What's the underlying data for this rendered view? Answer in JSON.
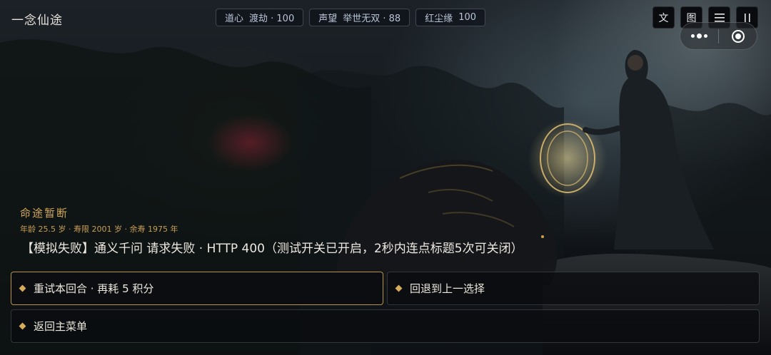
{
  "app": {
    "title": "一念仙途"
  },
  "stats": [
    {
      "label": "道心",
      "value": "渡劫 · 100"
    },
    {
      "label": "声望",
      "value": "举世无双 · 88"
    },
    {
      "label": "红尘缘",
      "value": "100"
    }
  ],
  "toolbar": {
    "text_label": "文",
    "image_label": "图",
    "menu_icon": "menu-icon",
    "pause_icon": "pause-icon"
  },
  "capsule": {
    "more_icon": "more-dots-icon",
    "close_icon": "target-close-icon"
  },
  "fate": {
    "title": "命途暂断",
    "meta": "年龄 25.5 岁 · 寿限 2001 岁 · 余寿 1975 年",
    "message": "【模拟失败】通义千问 请求失败 · HTTP 400（测试开关已开启，2秒内连点标题5次可关闭）"
  },
  "options": [
    {
      "label": "重试本回合 · 再耗 5 积分"
    },
    {
      "label": "回退到上一选择"
    },
    {
      "label": "返回主菜单"
    }
  ],
  "colors": {
    "accent_gold": "#d6ab5c",
    "text_light": "#ece8e0",
    "pill_text": "#b9c3d6"
  }
}
